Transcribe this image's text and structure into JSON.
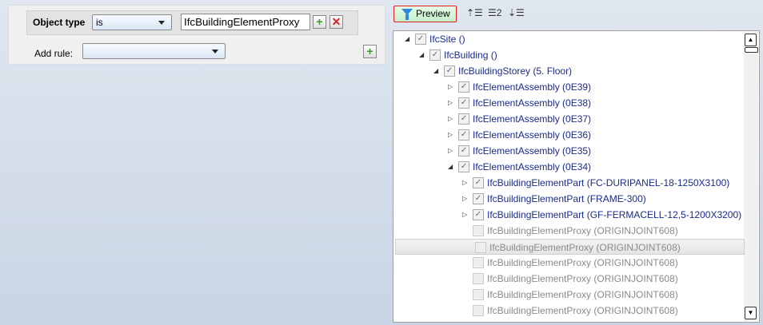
{
  "filter": {
    "object_type_label": "Object type",
    "operator": "is",
    "value": "IfcBuildingElementProxy",
    "add_rule_label": "Add rule:",
    "add_rule_value": ""
  },
  "toolbar": {
    "preview_label": "Preview",
    "level_label": "2"
  },
  "tree": [
    {
      "label": "IfcSite ()",
      "level": 0,
      "exp": "open",
      "checked": true,
      "enabled": true
    },
    {
      "label": "IfcBuilding ()",
      "level": 1,
      "exp": "open",
      "checked": true,
      "enabled": true
    },
    {
      "label": "IfcBuildingStorey (5. Floor)",
      "level": 2,
      "exp": "open",
      "checked": true,
      "enabled": true
    },
    {
      "label": "IfcElementAssembly (0E39)",
      "level": 3,
      "exp": "closed",
      "checked": true,
      "enabled": true
    },
    {
      "label": "IfcElementAssembly (0E38)",
      "level": 3,
      "exp": "closed",
      "checked": true,
      "enabled": true
    },
    {
      "label": "IfcElementAssembly (0E37)",
      "level": 3,
      "exp": "closed",
      "checked": true,
      "enabled": true
    },
    {
      "label": "IfcElementAssembly (0E36)",
      "level": 3,
      "exp": "closed",
      "checked": true,
      "enabled": true
    },
    {
      "label": "IfcElementAssembly (0E35)",
      "level": 3,
      "exp": "closed",
      "checked": true,
      "enabled": true
    },
    {
      "label": "IfcElementAssembly (0E34)",
      "level": 3,
      "exp": "open",
      "checked": true,
      "enabled": true
    },
    {
      "label": "IfcBuildingElementPart (FC-DURIPANEL-18-1250X3100)",
      "level": 4,
      "exp": "closed",
      "checked": true,
      "enabled": true
    },
    {
      "label": "IfcBuildingElementPart (FRAME-300)",
      "level": 4,
      "exp": "closed",
      "checked": true,
      "enabled": true
    },
    {
      "label": "IfcBuildingElementPart (GF-FERMACELL-12,5-1200X3200)",
      "level": 4,
      "exp": "closed",
      "checked": true,
      "enabled": true
    },
    {
      "label": "IfcBuildingElementProxy (ORIGINJOINT608)",
      "level": 4,
      "exp": "none",
      "checked": false,
      "enabled": false
    },
    {
      "label": "IfcBuildingElementProxy (ORIGINJOINT608)",
      "level": 4,
      "exp": "none",
      "checked": false,
      "enabled": false,
      "selected": true
    },
    {
      "label": "IfcBuildingElementProxy (ORIGINJOINT608)",
      "level": 4,
      "exp": "none",
      "checked": false,
      "enabled": false
    },
    {
      "label": "IfcBuildingElementProxy (ORIGINJOINT608)",
      "level": 4,
      "exp": "none",
      "checked": false,
      "enabled": false
    },
    {
      "label": "IfcBuildingElementProxy (ORIGINJOINT608)",
      "level": 4,
      "exp": "none",
      "checked": false,
      "enabled": false
    },
    {
      "label": "IfcBuildingElementProxy (ORIGINJOINT608)",
      "level": 4,
      "exp": "none",
      "checked": false,
      "enabled": false
    }
  ]
}
